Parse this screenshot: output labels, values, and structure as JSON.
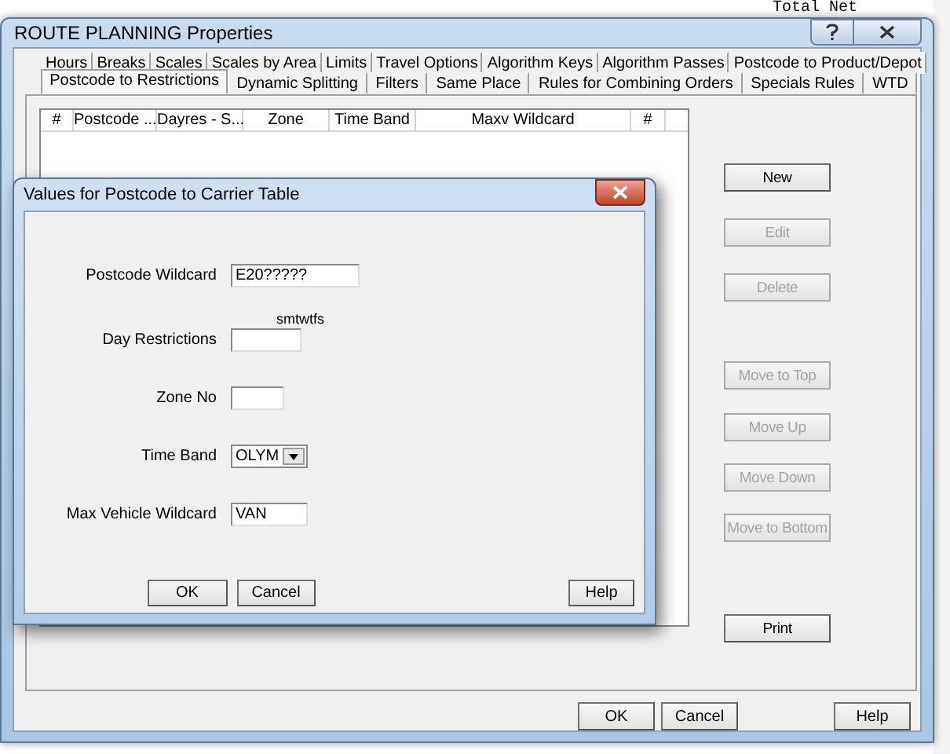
{
  "background": {
    "text": "Total Net"
  },
  "window": {
    "title": "ROUTE PLANNING Properties"
  },
  "tabs": [
    [
      {
        "label": "Hours",
        "selected": false
      },
      {
        "label": "Breaks",
        "selected": false
      },
      {
        "label": "Scales",
        "selected": false
      },
      {
        "label": "Scales by Area",
        "selected": false
      },
      {
        "label": "Limits",
        "selected": false
      },
      {
        "label": "Travel Options",
        "selected": false
      },
      {
        "label": "Algorithm Keys",
        "selected": false
      },
      {
        "label": "Algorithm Passes",
        "selected": false
      },
      {
        "label": "Postcode to Product/Depot",
        "selected": false
      }
    ],
    [
      {
        "label": "Postcode to Restrictions",
        "selected": true
      },
      {
        "label": "Dynamic Splitting",
        "selected": false
      },
      {
        "label": "Filters",
        "selected": false
      },
      {
        "label": "Same Place",
        "selected": false
      },
      {
        "label": "Rules for Combining Orders",
        "selected": false
      },
      {
        "label": "Specials Rules",
        "selected": false
      },
      {
        "label": "WTD",
        "selected": false
      }
    ]
  ],
  "table": {
    "columns": [
      "#",
      "Postcode ...",
      "Dayres - S...",
      "Zone",
      "Time Band",
      "Maxv Wildcard",
      "#"
    ]
  },
  "side_buttons": [
    {
      "label": "New",
      "disabled": false
    },
    {
      "label": "Edit",
      "disabled": true
    },
    {
      "label": "Delete",
      "disabled": true
    },
    {
      "label": "Move to Top",
      "disabled": true
    },
    {
      "label": "Move Up",
      "disabled": true
    },
    {
      "label": "Move Down",
      "disabled": true
    },
    {
      "label": "Move to Bottom",
      "disabled": true
    },
    {
      "label": "Print",
      "disabled": false
    }
  ],
  "footer_buttons": [
    "OK",
    "Cancel",
    "Help"
  ],
  "dialog": {
    "title": "Values for Postcode to Carrier Table",
    "fields": [
      {
        "kind": "text",
        "label": "Postcode Wildcard",
        "value": "E20?????"
      },
      {
        "kind": "text",
        "label": "Day Restrictions",
        "hint": "smtwtfs"
      },
      {
        "kind": "text",
        "label": "Zone No"
      },
      {
        "kind": "select",
        "label": "Time Band",
        "value": "OLYM"
      },
      {
        "kind": "text",
        "label": "Max Vehicle  Wildcard",
        "value": "VAN"
      }
    ],
    "buttons": [
      "OK",
      "Cancel",
      "Help"
    ]
  }
}
